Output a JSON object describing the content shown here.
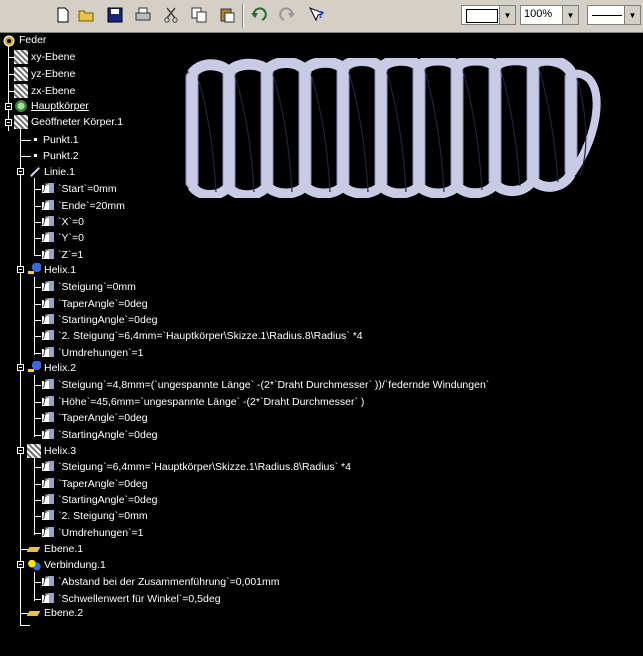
{
  "toolbar": {
    "zoom_value": "100%",
    "icons": [
      "new-icon",
      "open-icon",
      "save-icon",
      "print-icon",
      "cut-icon",
      "copy-icon",
      "paste-icon",
      "undo-icon",
      "redo-icon",
      "whats-this-icon"
    ]
  },
  "tree": {
    "root": "Feder",
    "planes": [
      "xy-Ebene",
      "yz-Ebene",
      "zx-Ebene"
    ],
    "main_body": "Hauptkörper",
    "open_body": "Geöffneter Körper.1",
    "punkt1": "Punkt.1",
    "punkt2": "Punkt.2",
    "linie": {
      "label": "Linie.1",
      "params": [
        "`Start`=0mm",
        "`Ende`=20mm",
        "`X`=0",
        "`Y`=0",
        "`Z`=1"
      ]
    },
    "helix1": {
      "label": "Helix.1",
      "params": [
        "`Steigung`=0mm",
        "`TaperAngle`=0deg",
        "`StartingAngle`=0deg",
        "`2. Steigung`=6,4mm=`Hauptkörper\\Skizze.1\\Radius.8\\Radius` *4",
        "`Umdrehungen`=1"
      ]
    },
    "helix2": {
      "label": "Helix.2",
      "params": [
        "`Steigung`=4,8mm=(`ungespannte Länge` -(2*`Draht Durchmesser` ))/`federnde Windungen`",
        "`Höhe`=45,6mm=`ungespannte Länge` -(2*`Draht Durchmesser` )",
        "`TaperAngle`=0deg",
        "`StartingAngle`=0deg"
      ]
    },
    "helix3": {
      "label": "Helix.3",
      "params": [
        "`Steigung`=6,4mm=`Hauptkörper\\Skizze.1\\Radius.8\\Radius` *4",
        "`TaperAngle`=0deg",
        "`StartingAngle`=0deg",
        "`2. Steigung`=0mm",
        "`Umdrehungen`=1"
      ]
    },
    "ebene1": "Ebene.1",
    "verbindung": {
      "label": "Verbindung.1",
      "params": [
        "`Abstand bei der Zusammenführung`=0,001mm",
        "`Schwellenwert für Winkel`=0,5deg"
      ]
    },
    "ebene2": "Ebene.2"
  },
  "colors": {
    "background": "#000000",
    "tree_line": "#ffffff",
    "spring": "#c9cbe6",
    "toolbar": "#d4d0c8"
  }
}
